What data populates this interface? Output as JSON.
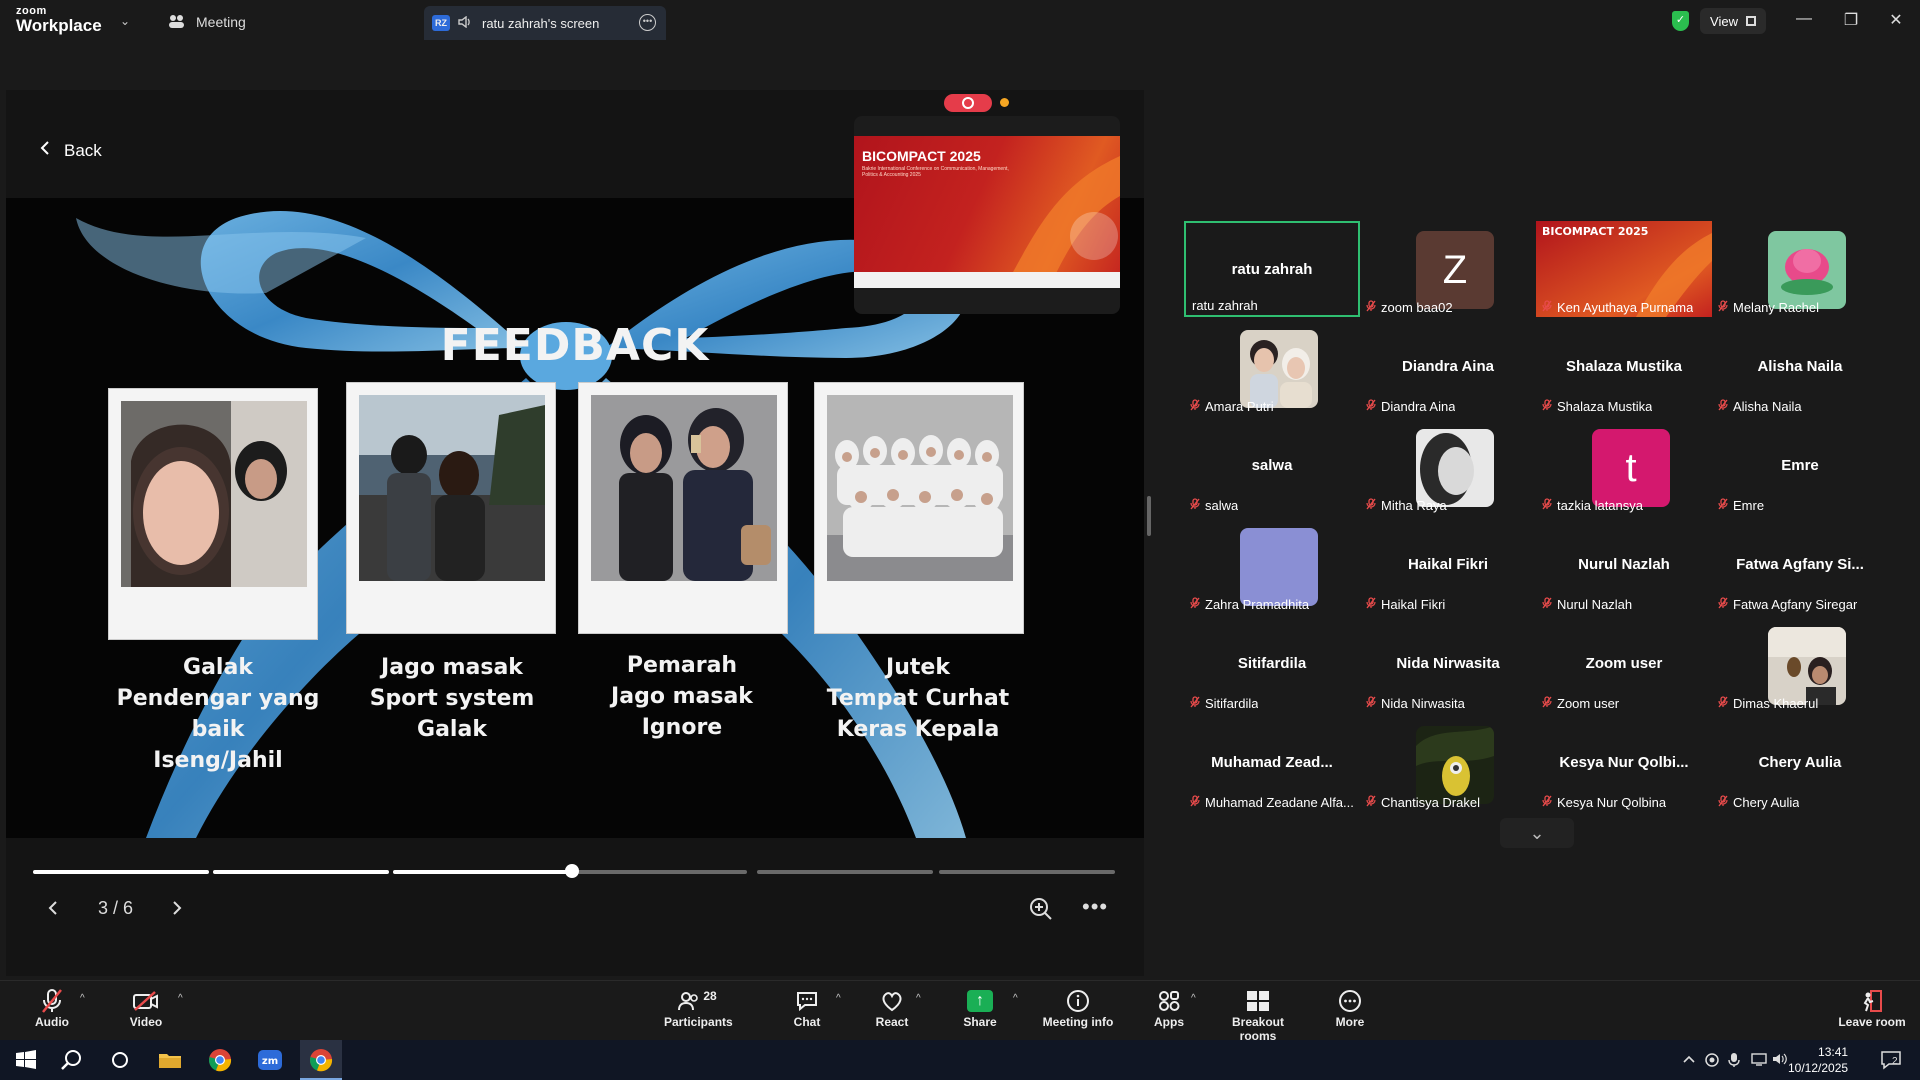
{
  "app": {
    "brand_top": "zoom",
    "brand_bottom": "Workplace",
    "brand_caret": "⌄"
  },
  "tabs": {
    "meeting": "Meeting",
    "share_badge": "RZ",
    "share": "ratu zahrah's screen"
  },
  "titlebar": {
    "view_label": "View"
  },
  "shared": {
    "back_label": "Back",
    "slide_title": "FEEDBACK",
    "captions": [
      [
        "Galak",
        "Pendengar yang baik",
        "Iseng/Jahil"
      ],
      [
        "Jago masak",
        "Sport system",
        "Galak"
      ],
      [
        "Pemarah",
        "Jago masak",
        "Ignore"
      ],
      [
        "Jutek",
        "Tempat Curhat",
        "Keras Kepala"
      ]
    ],
    "pip_title": "BICOMPACT 2025",
    "pip_subtitle": "Bakrie International Conference on Communication, Management, Politics & Accounting 2025",
    "page_indicator": "3 / 6",
    "progress": {
      "current_segment": 3,
      "total_segments": 6,
      "segment_progress": 0.98
    }
  },
  "gallery": [
    {
      "name": "ratu zahrah",
      "big": "ratu zahrah",
      "muted": false,
      "active": true
    },
    {
      "name": "zoom baa02",
      "avatar_letter": "Z",
      "avatar_color": "#5a3a32",
      "muted": true
    },
    {
      "name": "Ken Ayuthaya Purnama",
      "video": "bicompact",
      "muted": true
    },
    {
      "name": "Melany Rachel",
      "video": "flower",
      "muted": true
    },
    {
      "name": "Amara Putri",
      "video": "couple",
      "muted": true
    },
    {
      "name": "Diandra Aina",
      "big": "Diandra Aina",
      "muted": true
    },
    {
      "name": "Shalaza Mustika",
      "big": "Shalaza Mustika",
      "muted": true
    },
    {
      "name": "Alisha Naila",
      "big": "Alisha Naila",
      "muted": true
    },
    {
      "name": "salwa",
      "big": "salwa",
      "muted": true
    },
    {
      "name": "Mitha Raya",
      "video": "bw",
      "muted": true
    },
    {
      "name": "tazkia latansya",
      "avatar_letter": "t",
      "avatar_color": "#d4186e",
      "muted": true
    },
    {
      "name": "Emre",
      "big": "Emre",
      "muted": true
    },
    {
      "name": "Zahra Pramadhita",
      "avatar_letter": "",
      "avatar_color": "#8a8fd4",
      "muted": true
    },
    {
      "name": "Haikal Fikri",
      "big": "Haikal Fikri",
      "muted": true
    },
    {
      "name": "Nurul Nazlah",
      "big": "Nurul Nazlah",
      "muted": true
    },
    {
      "name": "Fatwa Agfany Siregar",
      "big": "Fatwa Agfany Si...",
      "muted": true
    },
    {
      "name": "Sitifardila",
      "big": "Sitifardila",
      "muted": true
    },
    {
      "name": "Nida Nirwasita",
      "big": "Nida Nirwasita",
      "muted": true
    },
    {
      "name": "Zoom user",
      "big": "Zoom user",
      "muted": true
    },
    {
      "name": "Dimas Khaerul",
      "video": "room",
      "muted": true
    },
    {
      "name": "Muhamad Zeadane Alfa...",
      "big": "Muhamad  Zead...",
      "muted": true
    },
    {
      "name": "Chantisya Drakel",
      "video": "minion",
      "muted": true
    },
    {
      "name": "Kesya Nur Qolbina",
      "big": "Kesya  Nur  Qolbi...",
      "muted": true
    },
    {
      "name": "Chery Aulia",
      "big": "Chery Aulia",
      "muted": true
    }
  ],
  "toolbar": {
    "audio": "Audio",
    "video": "Video",
    "participants": "Participants",
    "participants_count": "28",
    "chat": "Chat",
    "react": "React",
    "share": "Share",
    "meeting_info": "Meeting info",
    "apps": "Apps",
    "breakout": "Breakout rooms",
    "more": "More",
    "leave": "Leave room"
  },
  "taskbar": {
    "time": "13:41",
    "date": "10/12/2025",
    "notif_count": "2"
  },
  "colors": {
    "accent_green": "#2fbf71",
    "muted_red": "#e84b4b",
    "share_green": "#1aaf55",
    "zoom_blue": "#2d6bd9"
  }
}
